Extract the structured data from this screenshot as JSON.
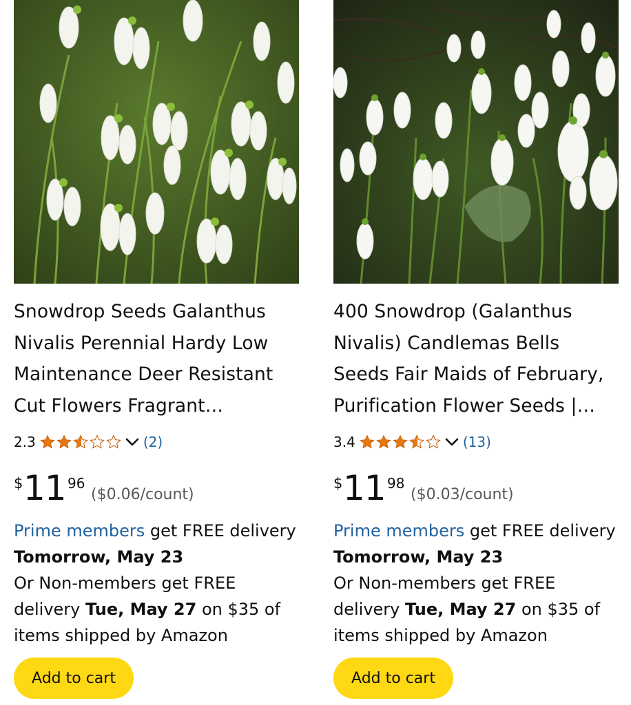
{
  "products": [
    {
      "image_desc": "snowdrop-flowers-photo",
      "title": "Snowdrop Seeds Galanthus Nivalis Perennial Hardy Low Maintenance Deer Resistant Cut Flowers Fragrant…",
      "rating_value": "2.3",
      "rating_stars": 2.5,
      "review_count": "(2)",
      "price_currency": "$",
      "price_whole": "11",
      "price_fraction": "96",
      "unit_price": "($0.06/count)",
      "prime_link": "Prime members",
      "prime_text": " get FREE delivery",
      "prime_date": "Tomorrow, May 23",
      "nonmember_text": "Or Non-members get FREE delivery ",
      "nonmember_date": "Tue, May 27",
      "nonmember_tail": " on $35 of items shipped by Amazon",
      "cart_label": "Add to cart"
    },
    {
      "image_desc": "snowdrop-flowers-photo",
      "title": "400 Snowdrop (Galanthus Nivalis) Candlemas Bells Seeds Fair Maids of February, Purification Flower Seeds |…",
      "rating_value": "3.4",
      "rating_stars": 3.5,
      "review_count": "(13)",
      "price_currency": "$",
      "price_whole": "11",
      "price_fraction": "98",
      "unit_price": "($0.03/count)",
      "prime_link": "Prime members",
      "prime_text": " get FREE delivery",
      "prime_date": "Tomorrow, May 23",
      "nonmember_text": "Or Non-members get FREE delivery ",
      "nonmember_date": "Tue, May 27",
      "nonmember_tail": " on $35 of items shipped by Amazon",
      "cart_label": "Add to cart"
    }
  ],
  "colors": {
    "star": "#e47911",
    "link": "#2162a1",
    "button": "#ffd814",
    "text": "#0f1111",
    "muted": "#565959"
  },
  "icons": {
    "rating_toggle": "chevron-down-icon",
    "star_full": "star-full-icon",
    "star_half": "star-half-icon",
    "star_empty": "star-empty-icon"
  }
}
